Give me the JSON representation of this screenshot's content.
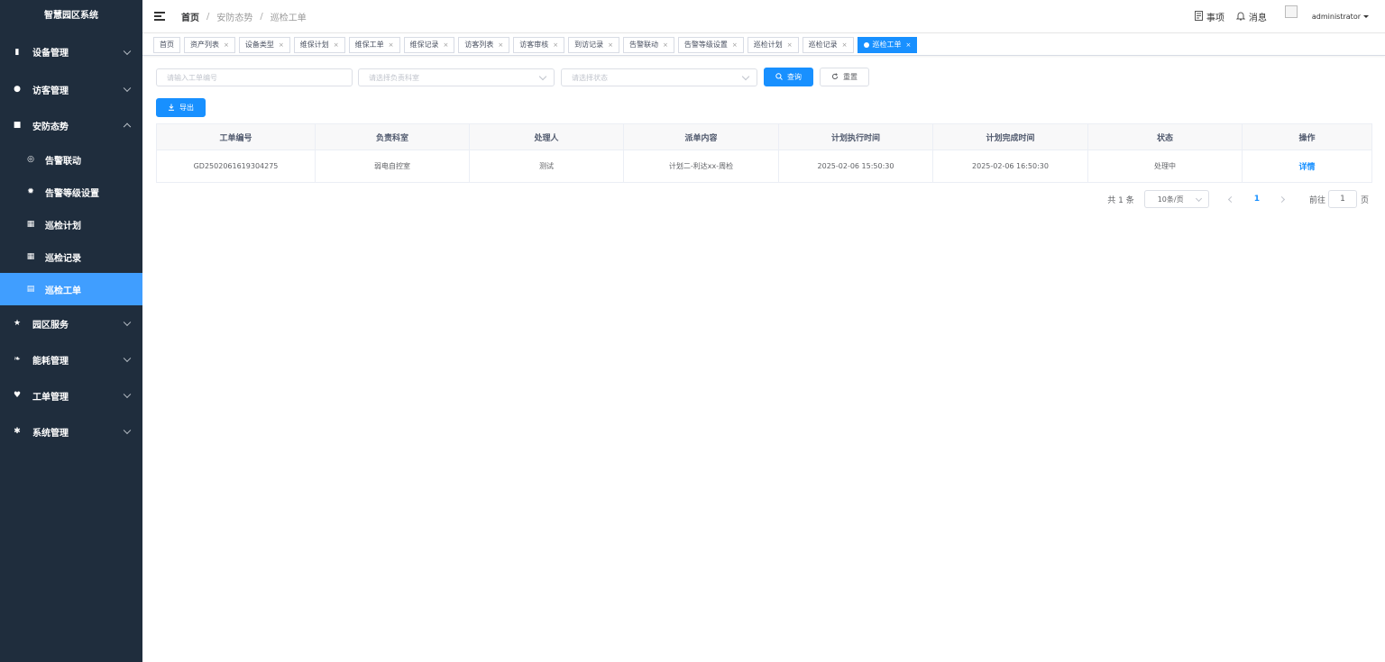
{
  "app": {
    "title": "智慧园区系统"
  },
  "sidebar": {
    "items": [
      {
        "label": "设备管理",
        "icon": "bookmark-icon",
        "glyph": "▮"
      },
      {
        "label": "访客管理",
        "icon": "user-icon",
        "glyph": "●"
      },
      {
        "label": "安防态势",
        "icon": "lock-icon",
        "glyph": "■"
      },
      {
        "label": "园区服务",
        "icon": "star-icon",
        "glyph": "★"
      },
      {
        "label": "能耗管理",
        "icon": "leaf-icon",
        "glyph": "❧"
      },
      {
        "label": "工单管理",
        "icon": "heart-icon",
        "glyph": "♥"
      },
      {
        "label": "系统管理",
        "icon": "gear-icon",
        "glyph": "✱"
      }
    ],
    "subitems": [
      {
        "label": "告警联动",
        "icon": "dashboard-icon",
        "glyph": "◎"
      },
      {
        "label": "告警等级设置",
        "icon": "gear-icon",
        "glyph": "✹"
      },
      {
        "label": "巡检计划",
        "icon": "grid-icon",
        "glyph": "▦"
      },
      {
        "label": "巡检记录",
        "icon": "grid-icon",
        "glyph": "▦"
      },
      {
        "label": "巡检工单",
        "icon": "table-icon",
        "glyph": "▤"
      }
    ]
  },
  "header": {
    "breadcrumb": [
      "首页",
      "安防态势",
      "巡检工单"
    ],
    "separator": "/",
    "tasks_label": "事项",
    "messages_label": "消息",
    "username": "administrator"
  },
  "tags": [
    {
      "label": "首页",
      "closable": false
    },
    {
      "label": "资产列表",
      "closable": true
    },
    {
      "label": "设备类型",
      "closable": true
    },
    {
      "label": "维保计划",
      "closable": true
    },
    {
      "label": "维保工单",
      "closable": true
    },
    {
      "label": "维保记录",
      "closable": true
    },
    {
      "label": "访客列表",
      "closable": true
    },
    {
      "label": "访客审核",
      "closable": true
    },
    {
      "label": "到访记录",
      "closable": true
    },
    {
      "label": "告警联动",
      "closable": true
    },
    {
      "label": "告警等级设置",
      "closable": true
    },
    {
      "label": "巡检计划",
      "closable": true
    },
    {
      "label": "巡检记录",
      "closable": true
    },
    {
      "label": "巡检工单",
      "closable": true,
      "active": true
    }
  ],
  "tag_close_glyph": "×",
  "filters": {
    "order_no_placeholder": "请输入工单编号",
    "department_placeholder": "请选择负责科室",
    "status_placeholder": "请选择状态",
    "search_label": "查询",
    "reset_label": "重置",
    "export_label": "导出"
  },
  "table": {
    "columns": [
      "工单编号",
      "负责科室",
      "处理人",
      "派单内容",
      "计划执行时间",
      "计划完成时间",
      "状态",
      "操作"
    ],
    "rows": [
      [
        "GD2502061619304275",
        "弱电自控室",
        "测试",
        "计划二-利达xx-周检",
        "2025-02-06 15:50:30",
        "2025-02-06 16:50:30",
        "处理中",
        "详情"
      ]
    ]
  },
  "pagination": {
    "total_text": "共 1 条",
    "page_size": "10条/页",
    "current_page": "1",
    "goto_label": "前往",
    "goto_value": "1",
    "page_suffix": "页"
  },
  "colors": {
    "sidebar_bg": "#1f2d3d",
    "accent": "#1890ff",
    "active_menu": "#409eff"
  }
}
